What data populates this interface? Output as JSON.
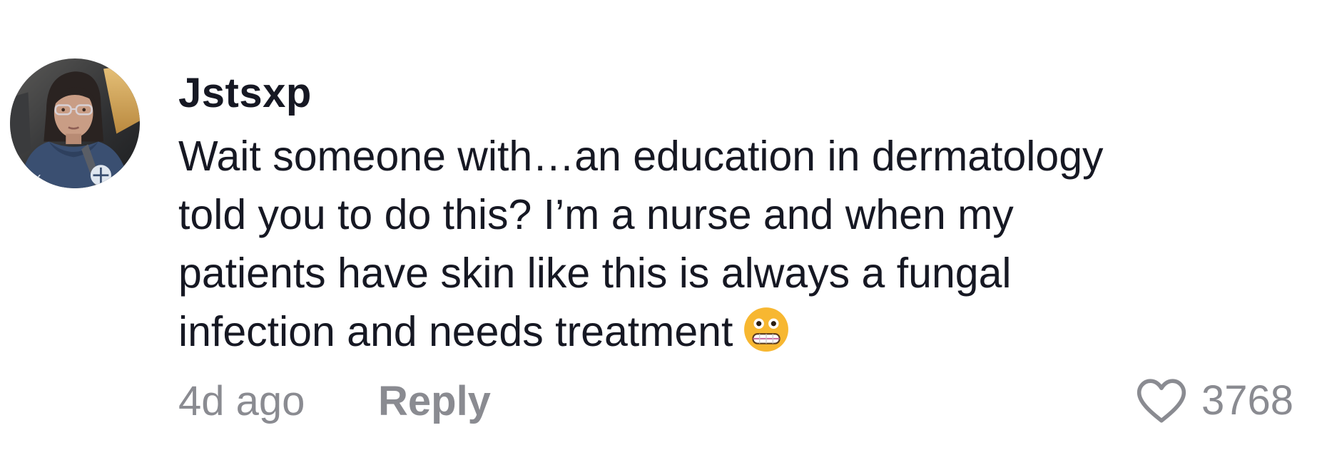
{
  "comment": {
    "username": "Jstsxp",
    "text_lines": [
      "Wait someone with…an education in dermatology",
      "told you to do this? I’m a nurse and when my",
      "patients have skin like this is always a fungal",
      "infection and needs treatment"
    ],
    "emoji_icon": "grimacing-face-icon",
    "time": "4d ago",
    "reply_label": "Reply",
    "like_icon": "heart-outline-icon",
    "like_count": "3768"
  },
  "colors": {
    "text_primary": "#161823",
    "text_secondary": "#8a8b91",
    "emoji_face": "#f7b731"
  }
}
